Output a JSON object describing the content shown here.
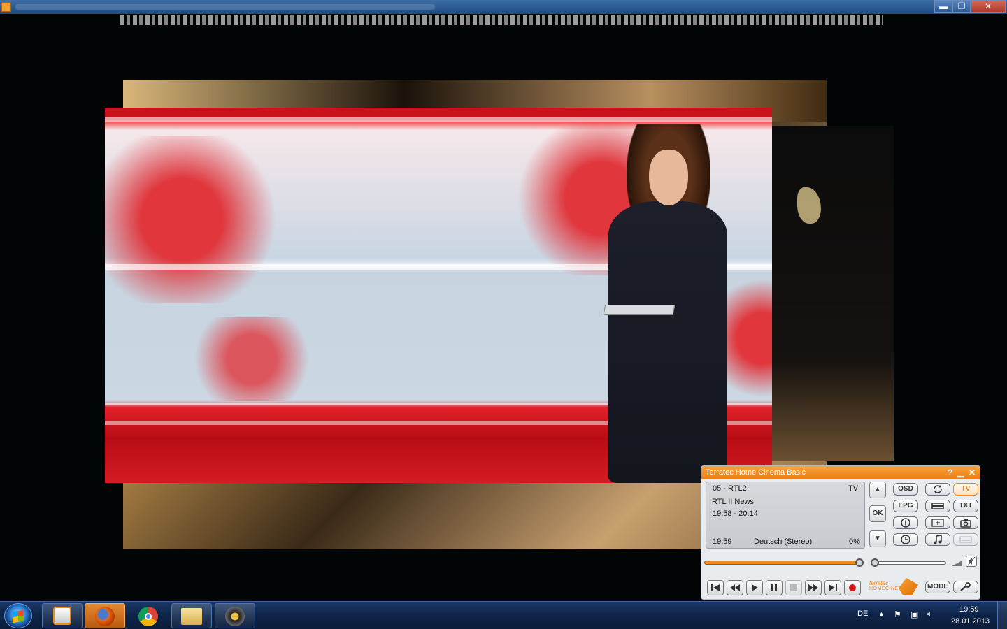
{
  "window": {
    "min_glyph": "▬",
    "max_glyph": "❐",
    "close_glyph": "✕"
  },
  "player": {
    "title": "Terratec Home Cinema Basic",
    "help_glyph": "?",
    "min_glyph": "▁",
    "close_glyph": "✕",
    "lcd": {
      "channel": "05 - RTL2",
      "mode": "TV",
      "program": "RTL II News",
      "time_range": "19:58 - 20:14",
      "current_time": "19:59",
      "audio": "Deutsch (Stereo)",
      "progress_text": "0%"
    },
    "side_buttons": {
      "up": "▲",
      "ok": "OK",
      "down": "▼"
    },
    "buttons": {
      "osd": "OSD",
      "epg": "EPG",
      "tv": "TV",
      "txt": "TXT",
      "mode": "MODE"
    },
    "seek_level": 1.0,
    "volume_level": 0.0,
    "logo": {
      "line1": "terratec",
      "line2": "HOMECINEMA"
    },
    "accent": "#f08a1c"
  },
  "taskbar": {
    "language": "DE",
    "time": "19:59",
    "date": "28.01.2013",
    "items": [
      {
        "name": "media-player",
        "icon": "media-player-icon"
      },
      {
        "name": "firefox",
        "icon": "firefox-icon"
      },
      {
        "name": "chrome",
        "icon": "chrome-icon"
      },
      {
        "name": "explorer",
        "icon": "folder-icon"
      },
      {
        "name": "terratec",
        "icon": "terratec-icon"
      }
    ]
  }
}
